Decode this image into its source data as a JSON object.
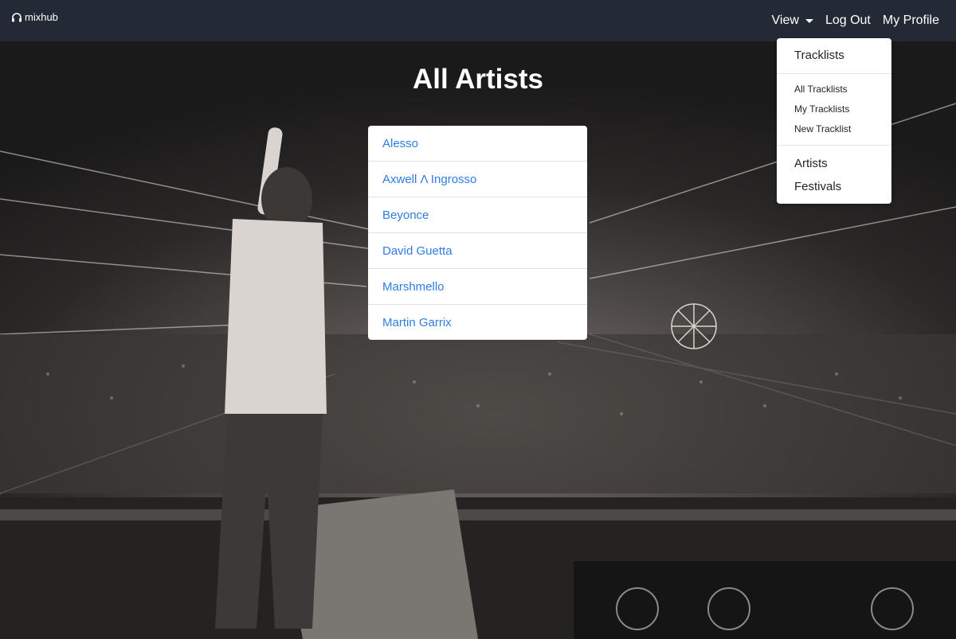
{
  "brand": {
    "name": "mixhub",
    "icon": "headphones-icon"
  },
  "nav": {
    "view_label": "View",
    "logout_label": "Log Out",
    "profile_label": "My Profile"
  },
  "dropdown": {
    "header": "Tracklists",
    "tracklist_items": [
      "All Tracklists",
      "My Tracklists",
      "New Tracklist"
    ],
    "section_items": [
      "Artists",
      "Festivals"
    ]
  },
  "page": {
    "title": "All Artists"
  },
  "artists": [
    "Alesso",
    "Axwell Λ Ingrosso",
    "Beyonce",
    "David Guetta",
    "Marshmello",
    "Martin Garrix"
  ],
  "colors": {
    "navbar": "#232a35",
    "link": "#2f7de1",
    "text": "#212529"
  }
}
